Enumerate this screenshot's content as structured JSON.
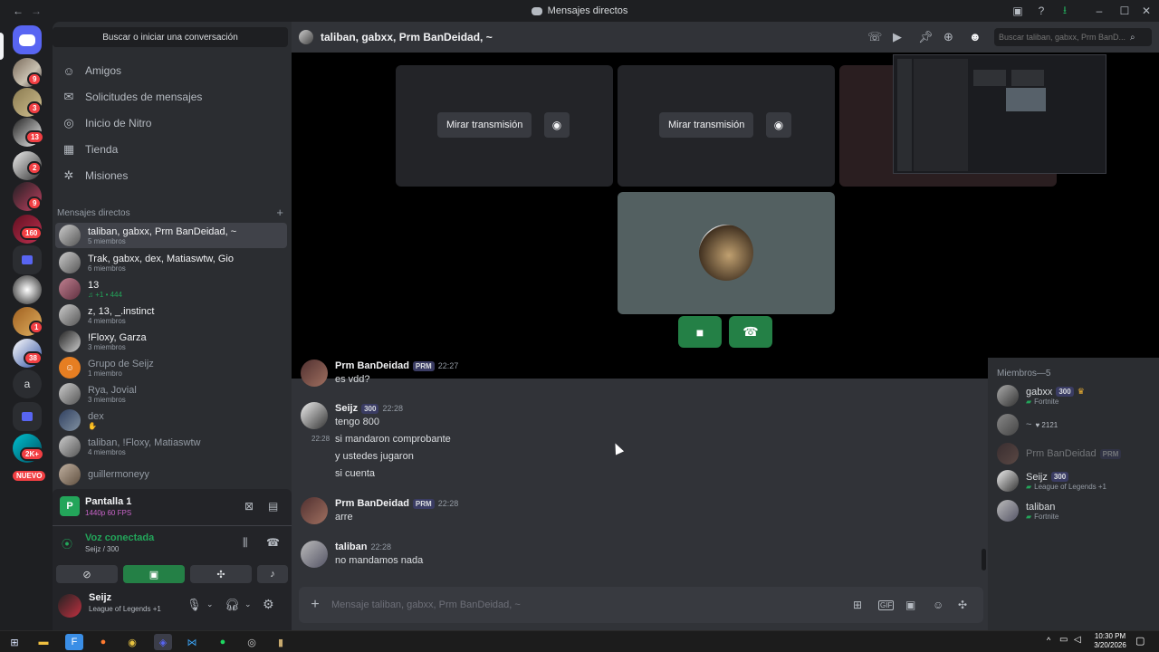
{
  "window": {
    "title": "Mensajes directos"
  },
  "servers": [
    {
      "badge": "9"
    },
    {
      "badge": "3"
    },
    {
      "badge": "13"
    },
    {
      "badge": "2"
    },
    {
      "badge": "9"
    },
    {
      "badge": "160"
    },
    {
      "badge": ""
    },
    {
      "badge": ""
    },
    {
      "badge": "1"
    },
    {
      "badge": "38"
    },
    {
      "letter": "a"
    },
    {
      "badge": ""
    },
    {
      "badge": "2K+"
    },
    {
      "badge": "NUEVO"
    }
  ],
  "dm_panel": {
    "search": "Buscar o iniciar una conversación",
    "nav": [
      {
        "label": "Amigos",
        "icon": "friends-icon"
      },
      {
        "label": "Solicitudes de mensajes",
        "icon": "envelope-icon"
      },
      {
        "label": "Inicio de Nitro",
        "icon": "nitro-icon"
      },
      {
        "label": "Tienda",
        "icon": "shop-icon"
      },
      {
        "label": "Misiones",
        "icon": "quests-icon"
      }
    ],
    "dm_header": "Mensajes directos",
    "dms": [
      {
        "name": "taliban, gabxx, Prm BanDeidad, ~",
        "sub": "5 miembros"
      },
      {
        "name": "Trak, gabxx, dex, Matiaswtw, Gio",
        "sub": "6 miembros"
      },
      {
        "name": "13",
        "sub": "♫ +1 • 444"
      },
      {
        "name": "z, 13, _.instinct",
        "sub": "4 miembros"
      },
      {
        "name": "!Floxy, Garza",
        "sub": "3 miembros"
      },
      {
        "name": "Grupo de Seijz",
        "sub": "1 miembro"
      },
      {
        "name": "Rya, Jovial",
        "sub": "3 miembros"
      },
      {
        "name": "dex",
        "sub": "✋"
      },
      {
        "name": "taliban, !Floxy, Matiaswtw",
        "sub": "4 miembros"
      },
      {
        "name": "guillermoneyy",
        "sub": ""
      }
    ]
  },
  "stream_panel": {
    "title": "Pantalla 1",
    "quality": "1440p 60 FPS",
    "voice": "Voz conectada",
    "voice_channel": "Seijz / 300"
  },
  "user": {
    "name": "Seijz",
    "activity": "League of Legends +1"
  },
  "chat": {
    "title": "taliban, gabxx, Prm BanDeidad, ~",
    "search_placeholder": "Buscar taliban, gabxx, Prm BanD...",
    "watch_label": "Mirar transmisión",
    "composer_placeholder": "Mensaje taliban, gabxx, Prm BanDeidad, ~"
  },
  "messages": [
    {
      "author": "Prm BanDeidad",
      "tag": "PRM",
      "time": "22:27",
      "lines": [
        "es vdd?"
      ]
    },
    {
      "author": "Seijz",
      "tag": "300",
      "time": "22:28",
      "lines": [
        "tengo 800",
        "si mandaron comprobante",
        "y ustedes jugaron",
        "si cuenta"
      ],
      "line_time": "22:28"
    },
    {
      "author": "Prm BanDeidad",
      "tag": "PRM",
      "time": "22:28",
      "lines": [
        "arre"
      ]
    },
    {
      "author": "taliban",
      "tag": "",
      "time": "22:28",
      "lines": [
        "no mandamos nada"
      ]
    }
  ],
  "members": {
    "header": "Miembros—5",
    "list": [
      {
        "name": "gabxx",
        "tag": "300",
        "activity": "Fortnite"
      },
      {
        "name": "~",
        "tag": "",
        "activity": "2121"
      },
      {
        "name": "Prm BanDeidad",
        "tag": "PRM",
        "activity": ""
      },
      {
        "name": "Seijz",
        "tag": "300",
        "activity": "League of Legends +1"
      },
      {
        "name": "taliban",
        "tag": "",
        "activity": "Fortnite"
      }
    ]
  },
  "taskbar": {
    "time": "10:30 PM",
    "date": "3/20/2026"
  },
  "colors": {
    "accent": "#5865f2",
    "green": "#248046",
    "bg": "#313338"
  }
}
